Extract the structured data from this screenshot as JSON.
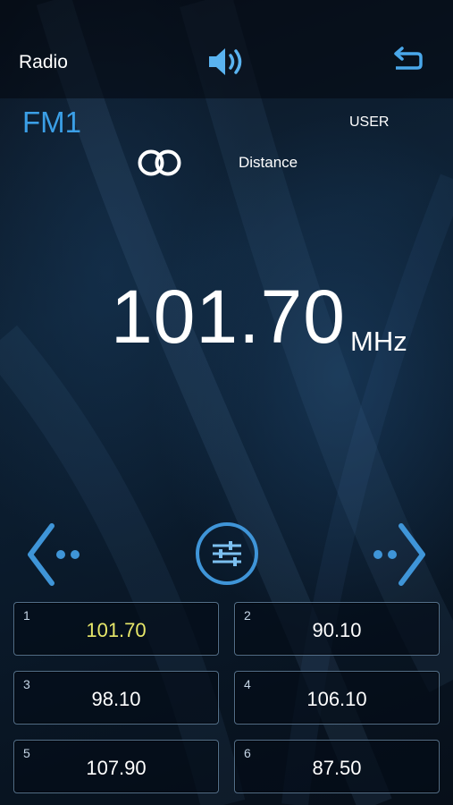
{
  "header": {
    "title": "Radio",
    "volume_icon": "volume-icon",
    "back_icon": "back-arrow-icon"
  },
  "status": {
    "band": "FM1",
    "mode": "USER",
    "stereo_icon": "stereo-icon",
    "reception": "Distance"
  },
  "tuner": {
    "frequency": "101.70",
    "unit": "MHz"
  },
  "controls": {
    "prev_icon": "seek-back-icon",
    "eq_icon": "equalizer-icon",
    "next_icon": "seek-forward-icon"
  },
  "presets": [
    {
      "number": "1",
      "frequency": "101.70",
      "active": true
    },
    {
      "number": "2",
      "frequency": "90.10",
      "active": false
    },
    {
      "number": "3",
      "frequency": "98.10",
      "active": false
    },
    {
      "number": "4",
      "frequency": "106.10",
      "active": false
    },
    {
      "number": "5",
      "frequency": "107.90",
      "active": false
    },
    {
      "number": "6",
      "frequency": "87.50",
      "active": false
    }
  ],
  "colors": {
    "accent": "#3b9fe6",
    "active_preset_text": "#e8e86a"
  }
}
